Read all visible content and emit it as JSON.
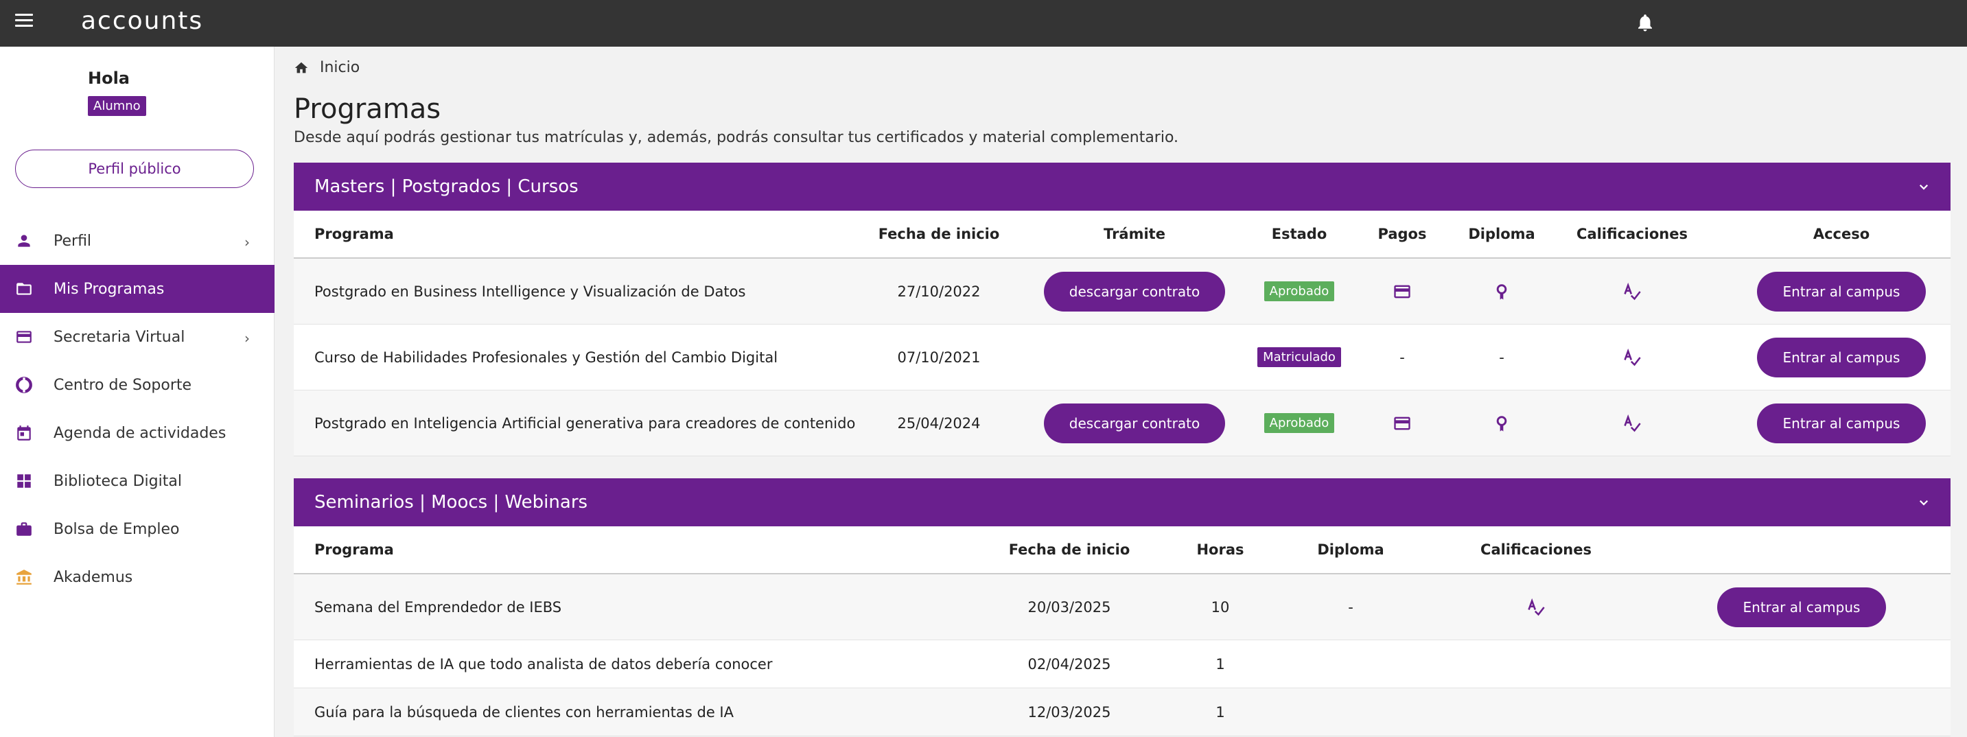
{
  "app": {
    "logo": "accounts"
  },
  "sidebar": {
    "greeting": "Hola",
    "role": "Alumno",
    "profile_button": "Perfil público",
    "items": [
      {
        "label": "Perfil",
        "icon": "person-icon",
        "has_chevron": true
      },
      {
        "label": "Mis Programas",
        "icon": "folder-open-icon",
        "active": true
      },
      {
        "label": "Secretaria Virtual",
        "icon": "credit-card-icon",
        "has_chevron": true
      },
      {
        "label": "Centro de Soporte",
        "icon": "lifebuoy-icon"
      },
      {
        "label": "Agenda de actividades",
        "icon": "calendar-icon"
      },
      {
        "label": "Biblioteca Digital",
        "icon": "grid-icon"
      },
      {
        "label": "Bolsa de Empleo",
        "icon": "briefcase-icon"
      },
      {
        "label": "Akademus",
        "icon": "institution-icon",
        "icon_color": "#e8a33d"
      }
    ]
  },
  "breadcrumb": {
    "home": "Inicio"
  },
  "page": {
    "title": "Programas",
    "description": "Desde aquí podrás gestionar tus matrículas y, además, podrás consultar tus certificados y material complementario."
  },
  "masters": {
    "title": "Masters | Postgrados | Cursos",
    "headers": {
      "programa": "Programa",
      "fecha": "Fecha de inicio",
      "tramite": "Trámite",
      "estado": "Estado",
      "pagos": "Pagos",
      "diploma": "Diploma",
      "calificaciones": "Calificaciones",
      "acceso": "Acceso"
    },
    "rows": [
      {
        "programa": "Postgrado en Business Intelligence y Visualización de Datos",
        "fecha": "27/10/2022",
        "tramite": "descargar contrato",
        "estado": "Aprobado",
        "estado_color": "#5cae5c",
        "acceso": "Entrar al campus"
      },
      {
        "programa": "Curso de Habilidades Profesionales y Gestión del Cambio Digital",
        "fecha": "07/10/2021",
        "tramite": "",
        "estado": "Matriculado",
        "estado_color": "#6a1f8e",
        "pagos": "-",
        "diploma": "-",
        "acceso": "Entrar al campus"
      },
      {
        "programa": "Postgrado en Inteligencia Artificial generativa para creadores de contenido",
        "fecha": "25/04/2024",
        "tramite": "descargar contrato",
        "estado": "Aprobado",
        "estado_color": "#5cae5c",
        "acceso": "Entrar al campus"
      }
    ]
  },
  "seminarios": {
    "title": "Seminarios | Moocs | Webinars",
    "headers": {
      "programa": "Programa",
      "fecha": "Fecha de inicio",
      "horas": "Horas",
      "diploma": "Diploma",
      "calificaciones": "Calificaciones"
    },
    "rows": [
      {
        "programa": "Semana del Emprendedor de IEBS",
        "fecha": "20/03/2025",
        "horas": "10",
        "diploma": "-",
        "acceso": "Entrar al campus"
      },
      {
        "programa": "Herramientas de IA que todo analista de datos debería conocer",
        "fecha": "02/04/2025",
        "horas": "1"
      },
      {
        "programa": "Guía para la búsqueda de clientes con herramientas de IA",
        "fecha": "12/03/2025",
        "horas": "1"
      }
    ]
  },
  "colors": {
    "brand": "#6a1f8e",
    "topbar": "#343434",
    "approved": "#5cae5c"
  }
}
